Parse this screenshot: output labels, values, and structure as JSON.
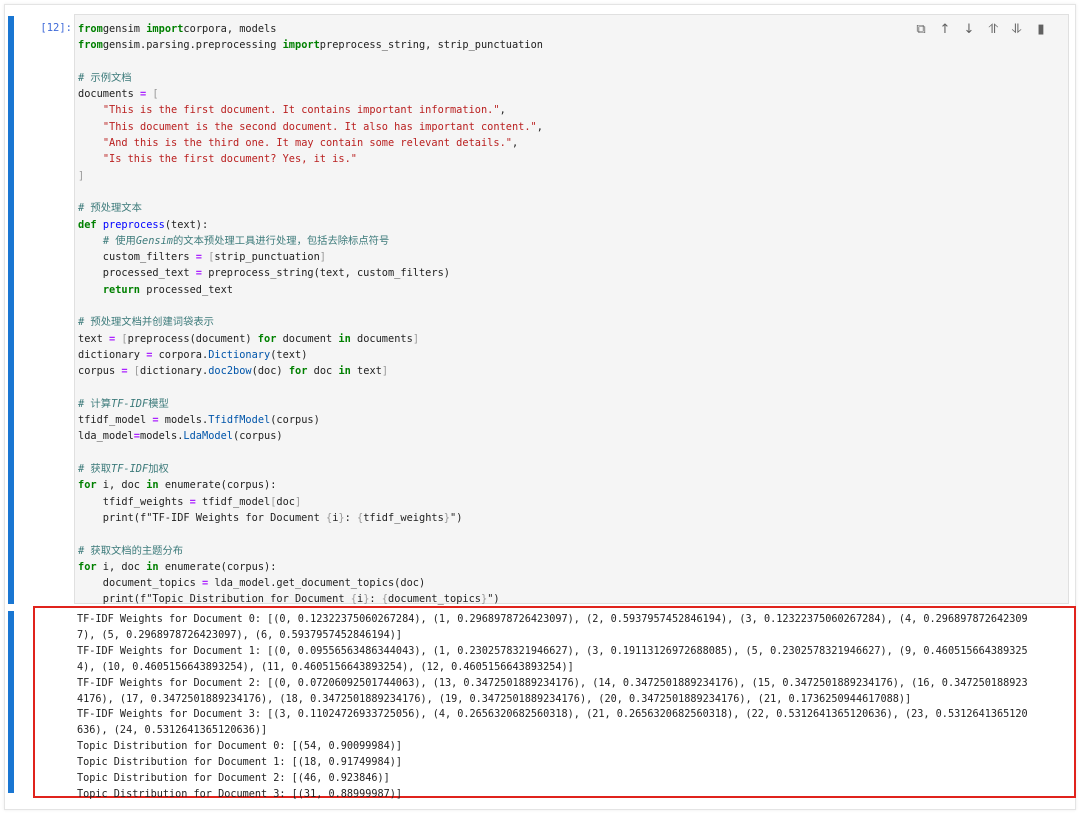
{
  "cell": {
    "prompt": "[12]:",
    "code_lines": [
      [
        [
          "kw",
          "from"
        ],
        [
          "",
          "gensim "
        ],
        [
          "kw",
          "import"
        ],
        [
          "",
          "corpora, models"
        ]
      ],
      [
        [
          "kw",
          "from"
        ],
        [
          "",
          "gensim.parsing.preprocessing "
        ],
        [
          "kw",
          "import"
        ],
        [
          "",
          "preprocess_string, strip_punctuation"
        ]
      ],
      [],
      [
        [
          "cm",
          "# 示例文档"
        ]
      ],
      [
        [
          "",
          "documents "
        ],
        [
          "op",
          "="
        ],
        [
          "br",
          " ["
        ]
      ],
      [
        [
          "",
          "    "
        ],
        [
          "str",
          "\"This is the first document. It contains important information.\""
        ],
        [
          "",
          ","
        ]
      ],
      [
        [
          "",
          "    "
        ],
        [
          "str",
          "\"This document is the second document. It also has important content.\""
        ],
        [
          "",
          ","
        ]
      ],
      [
        [
          "",
          "    "
        ],
        [
          "str",
          "\"And this is the third one. It may contain some relevant details.\""
        ],
        [
          "",
          ","
        ]
      ],
      [
        [
          "",
          "    "
        ],
        [
          "str",
          "\"Is this the first document? Yes, it is.\""
        ]
      ],
      [
        [
          "br",
          "]"
        ]
      ],
      [],
      [
        [
          "cm",
          "# 预处理文本"
        ]
      ],
      [
        [
          "kw",
          "def"
        ],
        [
          "",
          " "
        ],
        [
          "fn",
          "preprocess"
        ],
        [
          "",
          "(text):"
        ]
      ],
      [
        [
          "",
          "    "
        ],
        [
          "cm",
          "# 使用"
        ],
        [
          "cm em",
          "Gensim"
        ],
        [
          "cm",
          "的文本预处理工具进行处理，包括去除标点符号"
        ]
      ],
      [
        [
          "",
          "    custom_filters "
        ],
        [
          "op",
          "="
        ],
        [
          "br",
          " ["
        ],
        [
          "",
          "strip_punctuation"
        ],
        [
          "br",
          "]"
        ]
      ],
      [
        [
          "",
          "    processed_text "
        ],
        [
          "op",
          "="
        ],
        [
          "",
          " preprocess_string(text, custom_filters)"
        ]
      ],
      [
        [
          "",
          "    "
        ],
        [
          "kw",
          "return"
        ],
        [
          "",
          " processed_text"
        ]
      ],
      [],
      [
        [
          "cm",
          "# 预处理文档并创建词袋表示"
        ]
      ],
      [
        [
          "",
          "text "
        ],
        [
          "op",
          "="
        ],
        [
          "br",
          " ["
        ],
        [
          "",
          "preprocess(document) "
        ],
        [
          "kw",
          "for"
        ],
        [
          "",
          " document "
        ],
        [
          "kw",
          "in"
        ],
        [
          "",
          " documents"
        ],
        [
          "br",
          "]"
        ]
      ],
      [
        [
          "",
          "dictionary "
        ],
        [
          "op",
          "="
        ],
        [
          "",
          " corpora."
        ],
        [
          "bi",
          "Dictionary"
        ],
        [
          "",
          "(text)"
        ]
      ],
      [
        [
          "",
          "corpus "
        ],
        [
          "op",
          "="
        ],
        [
          "br",
          " ["
        ],
        [
          "",
          "dictionary."
        ],
        [
          "bi",
          "doc2bow"
        ],
        [
          "",
          "(doc) "
        ],
        [
          "kw",
          "for"
        ],
        [
          "",
          " doc "
        ],
        [
          "kw",
          "in"
        ],
        [
          "",
          " text"
        ],
        [
          "br",
          "]"
        ]
      ],
      [],
      [
        [
          "cm",
          "# 计算"
        ],
        [
          "cm em",
          "TF-IDF"
        ],
        [
          "cm",
          "模型"
        ]
      ],
      [
        [
          "",
          "tfidf_model "
        ],
        [
          "op",
          "="
        ],
        [
          "",
          " models."
        ],
        [
          "bi",
          "TfidfModel"
        ],
        [
          "",
          "(corpus)"
        ]
      ],
      [
        [
          "",
          "lda_model"
        ],
        [
          "op",
          "="
        ],
        [
          "",
          "models."
        ],
        [
          "bi",
          "LdaModel"
        ],
        [
          "",
          "(corpus)"
        ]
      ],
      [],
      [
        [
          "cm",
          "# 获取"
        ],
        [
          "cm em",
          "TF-IDF"
        ],
        [
          "cm",
          "加权"
        ]
      ],
      [
        [
          "kw",
          "for"
        ],
        [
          "",
          " i, doc "
        ],
        [
          "kw",
          "in"
        ],
        [
          "",
          " enumerate(corpus):"
        ]
      ],
      [
        [
          "",
          "    tfidf_weights "
        ],
        [
          "op",
          "="
        ],
        [
          "",
          " tfidf_model"
        ],
        [
          "br",
          "["
        ],
        [
          "",
          "doc"
        ],
        [
          "br",
          "]"
        ]
      ],
      [
        [
          "",
          "    print(f\"TF-IDF Weights for Document "
        ],
        [
          "br",
          "{"
        ],
        [
          "",
          "i"
        ],
        [
          "br",
          "}"
        ],
        [
          "",
          ": "
        ],
        [
          "br",
          "{"
        ],
        [
          "",
          "tfidf_weights"
        ],
        [
          "br",
          "}"
        ],
        [
          "",
          "\")"
        ]
      ],
      [],
      [
        [
          "cm",
          "# 获取文档的主题分布"
        ]
      ],
      [
        [
          "kw",
          "for"
        ],
        [
          "",
          " i, doc "
        ],
        [
          "kw",
          "in"
        ],
        [
          "",
          " enumerate(corpus):"
        ]
      ],
      [
        [
          "",
          "    document_topics "
        ],
        [
          "op",
          "="
        ],
        [
          "",
          " lda_model.get_document_topics(doc)"
        ]
      ],
      [
        [
          "",
          "    print(f\"Topic Distribution for Document "
        ],
        [
          "br",
          "{"
        ],
        [
          "",
          "i"
        ],
        [
          "br",
          "}"
        ],
        [
          "",
          ": "
        ],
        [
          "br",
          "{"
        ],
        [
          "",
          "document_topics"
        ],
        [
          "br",
          "}"
        ],
        [
          "",
          "\")"
        ]
      ]
    ],
    "output_lines": [
      "TF-IDF Weights for Document 0: [(0, 0.12322375060267284), (1, 0.2968978726423097), (2, 0.5937957452846194), (3, 0.12322375060267284), (4, 0.296897872642309",
      "7), (5, 0.2968978726423097), (6, 0.5937957452846194)]",
      "TF-IDF Weights for Document 1: [(0, 0.09556563486344043), (1, 0.2302578321946627), (3, 0.19113126972688085), (5, 0.2302578321946627), (9, 0.460515664389325",
      "4), (10, 0.4605156643893254), (11, 0.4605156643893254), (12, 0.4605156643893254)]",
      "TF-IDF Weights for Document 2: [(0, 0.07206092501744063), (13, 0.3472501889234176), (14, 0.3472501889234176), (15, 0.3472501889234176), (16, 0.347250188923",
      "4176), (17, 0.3472501889234176), (18, 0.3472501889234176), (19, 0.3472501889234176), (20, 0.3472501889234176), (21, 0.1736250944617088)]",
      "TF-IDF Weights for Document 3: [(3, 0.11024726933725056), (4, 0.2656320682560318), (21, 0.2656320682560318), (22, 0.5312641365120636), (23, 0.5312641365120",
      "636), (24, 0.5312641365120636)]",
      "Topic Distribution for Document 0: [(54, 0.90099984)]",
      "Topic Distribution for Document 1: [(18, 0.91749984)]",
      "Topic Distribution for Document 2: [(46, 0.923846)]",
      "Topic Distribution for Document 3: [(31, 0.88999987)]"
    ]
  },
  "toolbar": [
    {
      "name": "duplicate-icon",
      "glyph": "⧉"
    },
    {
      "name": "move-up-icon",
      "glyph": "↑"
    },
    {
      "name": "move-down-icon",
      "glyph": "↓"
    },
    {
      "name": "insert-above-icon",
      "glyph": "⥣"
    },
    {
      "name": "insert-below-icon",
      "glyph": "⥥"
    },
    {
      "name": "delete-icon",
      "glyph": "▮"
    }
  ],
  "colors": {
    "cell_active_bar": "#1976d2",
    "highlight_border": "#e0231c",
    "keyword": "#008000",
    "string": "#ba2121",
    "comment": "#3d7b7b"
  }
}
